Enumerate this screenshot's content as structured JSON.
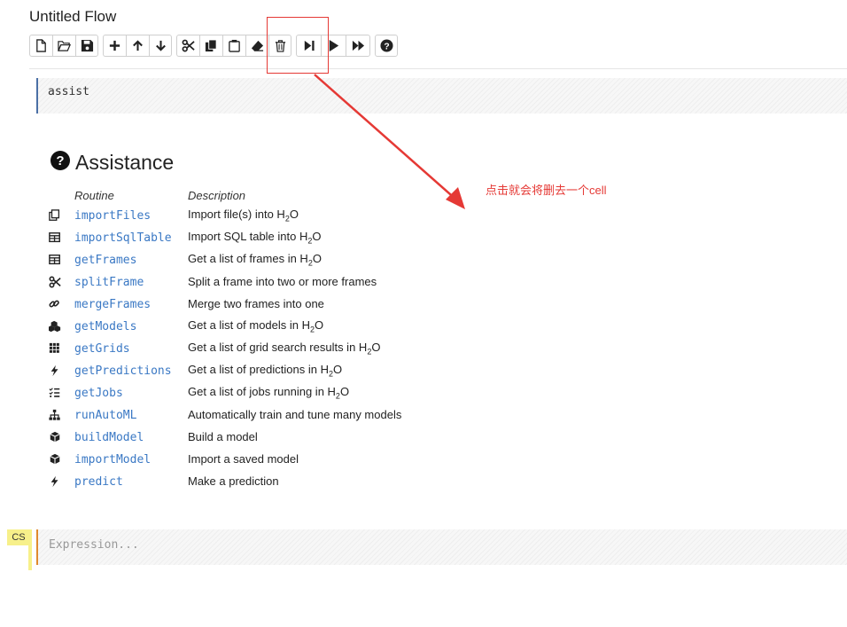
{
  "window": {
    "title": "Untitled Flow"
  },
  "toolbar": {
    "groups": [
      [
        "new-file-icon",
        "open-folder-icon",
        "save-icon"
      ],
      [
        "plus-icon",
        "arrow-up-icon",
        "arrow-down-icon"
      ],
      [
        "scissors-icon",
        "copy-icon",
        "paste-icon",
        "eraser-icon",
        "trash-icon"
      ],
      [
        "step-forward-icon",
        "play-icon",
        "fast-forward-icon"
      ],
      [
        "help-icon"
      ]
    ]
  },
  "cell1": {
    "code": "assist"
  },
  "assistance": {
    "title": "Assistance",
    "col_routine": "Routine",
    "col_description": "Description",
    "routines": [
      {
        "name": "importFiles",
        "icon": "files-icon",
        "desc": "Import file(s) into H",
        "sub": "2",
        "tail": "O"
      },
      {
        "name": "importSqlTable",
        "icon": "table-icon",
        "desc": "Import SQL table into H",
        "sub": "2",
        "tail": "O"
      },
      {
        "name": "getFrames",
        "icon": "table-icon",
        "desc": "Get a list of frames in H",
        "sub": "2",
        "tail": "O"
      },
      {
        "name": "splitFrame",
        "icon": "scissors-icon",
        "desc": "Split a frame into two or more frames",
        "sub": "",
        "tail": ""
      },
      {
        "name": "mergeFrames",
        "icon": "link-icon",
        "desc": "Merge two frames into one",
        "sub": "",
        "tail": ""
      },
      {
        "name": "getModels",
        "icon": "cubes-icon",
        "desc": "Get a list of models in H",
        "sub": "2",
        "tail": "O"
      },
      {
        "name": "getGrids",
        "icon": "grid-icon",
        "desc": "Get a list of grid search results in H",
        "sub": "2",
        "tail": "O"
      },
      {
        "name": "getPredictions",
        "icon": "bolt-icon",
        "desc": "Get a list of predictions in H",
        "sub": "2",
        "tail": "O"
      },
      {
        "name": "getJobs",
        "icon": "tasks-icon",
        "desc": "Get a list of jobs running in H",
        "sub": "2",
        "tail": "O"
      },
      {
        "name": "runAutoML",
        "icon": "sitemap-icon",
        "desc": "Automatically train and tune many models",
        "sub": "",
        "tail": ""
      },
      {
        "name": "buildModel",
        "icon": "cube-icon",
        "desc": "Build a model",
        "sub": "",
        "tail": ""
      },
      {
        "name": "importModel",
        "icon": "cube-icon",
        "desc": "Import a saved model",
        "sub": "",
        "tail": ""
      },
      {
        "name": "predict",
        "icon": "bolt-icon",
        "desc": "Make a prediction",
        "sub": "",
        "tail": ""
      }
    ]
  },
  "cell2": {
    "badge": "CS",
    "placeholder": "Expression..."
  },
  "annotation": {
    "text": "点击就会将删去一个cell",
    "color": "#e53935"
  },
  "colors": {
    "link": "#3a78c4",
    "cell_border": "#4a6fa5",
    "active_cell_border": "#e08a2e",
    "badge": "#f7f08a"
  }
}
